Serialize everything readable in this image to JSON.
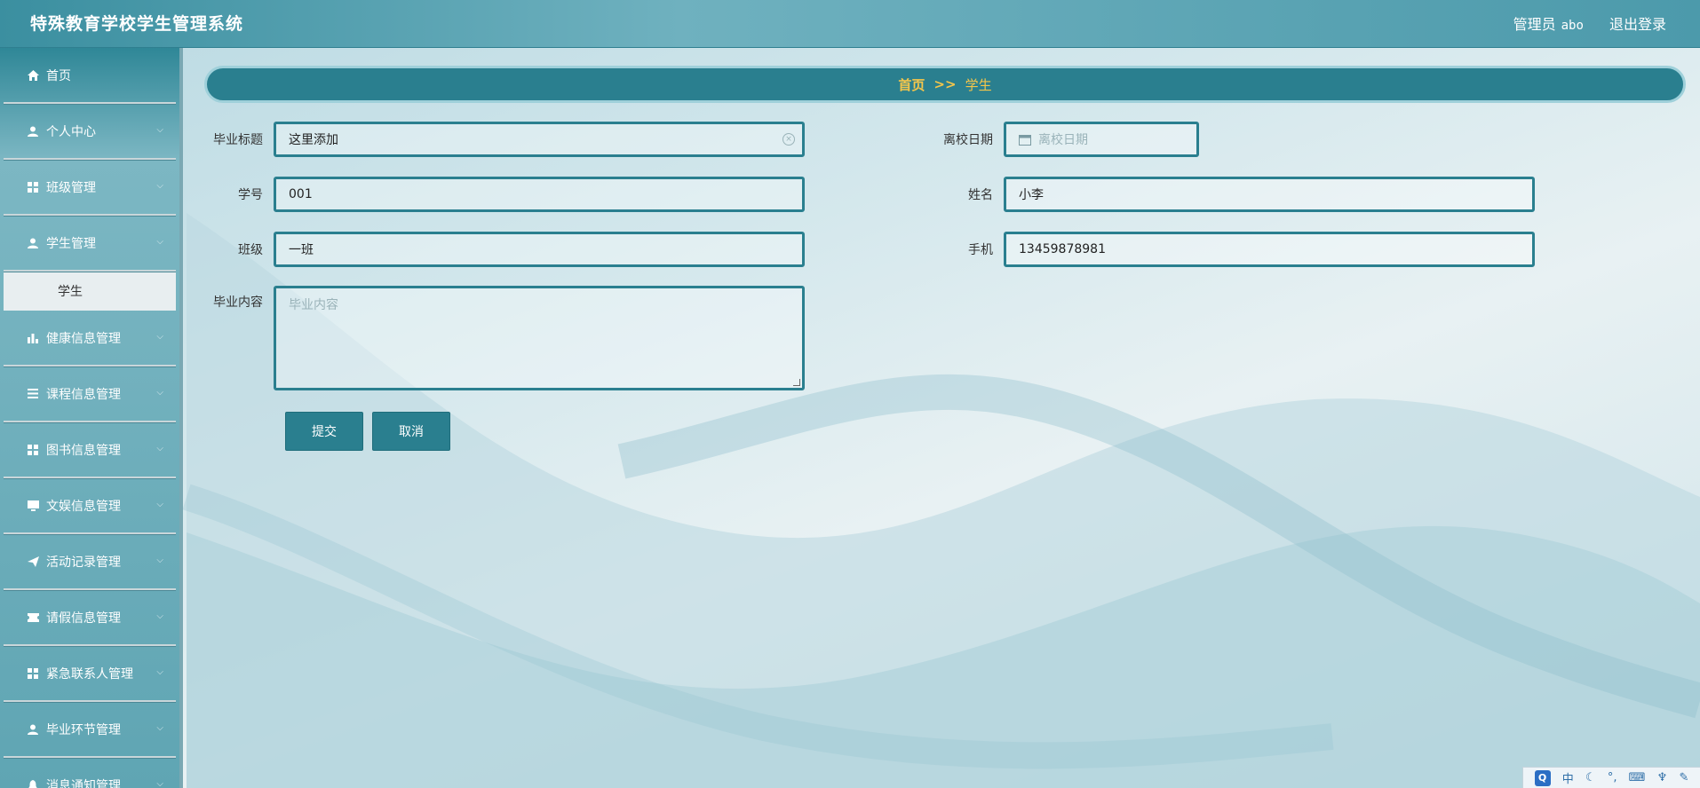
{
  "header": {
    "title": "特殊教育学校学生管理系统",
    "role_label": "管理员",
    "username": "abo",
    "logout_label": "退出登录"
  },
  "sidebar": {
    "items": [
      {
        "label": "首页",
        "icon": "home-icon",
        "has_chevron": false
      },
      {
        "label": "个人中心",
        "icon": "user-icon",
        "has_chevron": true
      },
      {
        "label": "班级管理",
        "icon": "grid-icon",
        "has_chevron": true
      },
      {
        "label": "学生管理",
        "icon": "user-icon",
        "has_chevron": true
      },
      {
        "label": "健康信息管理",
        "icon": "bar-chart-icon",
        "has_chevron": true
      },
      {
        "label": "课程信息管理",
        "icon": "list-icon",
        "has_chevron": true
      },
      {
        "label": "图书信息管理",
        "icon": "grid-icon",
        "has_chevron": true
      },
      {
        "label": "文娱信息管理",
        "icon": "monitor-icon",
        "has_chevron": true
      },
      {
        "label": "活动记录管理",
        "icon": "send-icon",
        "has_chevron": true
      },
      {
        "label": "请假信息管理",
        "icon": "ticket-icon",
        "has_chevron": true
      },
      {
        "label": "紧急联系人管理",
        "icon": "grid-icon",
        "has_chevron": true
      },
      {
        "label": "毕业环节管理",
        "icon": "user-icon",
        "has_chevron": true
      },
      {
        "label": "消息通知管理",
        "icon": "bell-icon",
        "has_chevron": true
      }
    ],
    "active_sub": "学生"
  },
  "breadcrumb": {
    "home": "首页",
    "separator": ">>",
    "current": "学生"
  },
  "form": {
    "grad_title_label": "毕业标题",
    "grad_title_value": "这里添加",
    "leave_date_label": "离校日期",
    "leave_date_placeholder": "离校日期",
    "student_no_label": "学号",
    "student_no_value": "001",
    "name_label": "姓名",
    "name_value": "小李",
    "class_label": "班级",
    "class_value": "一班",
    "phone_label": "手机",
    "phone_value": "13459878981",
    "content_label": "毕业内容",
    "content_placeholder": "毕业内容",
    "submit_label": "提交",
    "cancel_label": "取消"
  },
  "tray": {
    "ime_label": "中"
  },
  "colors": {
    "accent": "#2a7f8f",
    "breadcrumb_text": "#f5c64a",
    "header_bg": "#4c9aab"
  }
}
